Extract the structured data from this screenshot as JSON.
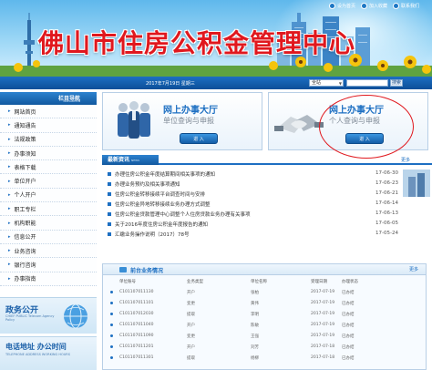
{
  "header": {
    "title": "佛山市住房公积金管理中心",
    "top_links": [
      "设为首页",
      "加入收藏",
      "联系我们"
    ]
  },
  "navbar": {
    "date": "2017年7月19日  星期三",
    "search_scope": "全站",
    "search_button": "搜索"
  },
  "sidebar": {
    "heading": "栏目导航",
    "heading_en": "NAVIGATION",
    "items": [
      "网站首页",
      "通知通告",
      "法规政策",
      "办事须知",
      "表格下载",
      "单位开户",
      "个人开户",
      "职工专栏",
      "机构职能",
      "信息公开",
      "业务咨询",
      "银行咨询",
      "办事指南"
    ],
    "gov_title": "政务公开",
    "gov_sub": "CHIEF PUBLIC Telecom Agency Policy",
    "phone_title": "电话地址  办公时间",
    "phone_sub": "TELEPHONE ADDRESS WORKING HOURS"
  },
  "cards": {
    "unit": {
      "title": "网上办事大厅",
      "sub": "单位查询与申报",
      "enter": "进 入"
    },
    "personal": {
      "title": "网上办事大厅",
      "sub": "个人查询与申报",
      "enter": "进 入"
    }
  },
  "news": {
    "heading": "最新资讯",
    "heading_en": "NEWS",
    "more": "更多",
    "items": [
      {
        "title": "办理住房公积金年度结算期间相关事项的通知",
        "date": "17-06-30"
      },
      {
        "title": "办理业务预约及相关事项通知",
        "date": "17-06-23"
      },
      {
        "title": "住房公积金转移接续平台调查时间与安排",
        "date": "17-06-21"
      },
      {
        "title": "住房公积金异地转移接续业务办理方式调整",
        "date": "17-06-14"
      },
      {
        "title": "住房公积金贷款管理中心调整个人住房贷款业务办理有关事项",
        "date": "17-06-13"
      },
      {
        "title": "关于2016年度住房公积金年度报告的通知",
        "date": "17-06-05"
      },
      {
        "title": "汇缴业务操作说明（2017）78号",
        "date": "17-05-24"
      }
    ]
  },
  "business": {
    "heading": "前台业务情况",
    "more": "更多",
    "columns": [
      "单位账号",
      "业务类型",
      "单位名称",
      "受理日期",
      "办理状态"
    ],
    "rows": [
      [
        "C101107011130",
        "开户",
        "张柏",
        "2017-07-19",
        "已办结"
      ],
      [
        "C101107011101",
        "变更",
        "黄伟",
        "2017-07-19",
        "已办结"
      ],
      [
        "C101107012030",
        "提取",
        "李明",
        "2017-07-19",
        "已办结"
      ],
      [
        "C101107011040",
        "开户",
        "陈敏",
        "2017-07-19",
        "已办结"
      ],
      [
        "C101107011090",
        "变更",
        "王强",
        "2017-07-19",
        "已办结"
      ],
      [
        "C101107011201",
        "开户",
        "刘芳",
        "2017-07-18",
        "已办结"
      ],
      [
        "C101107011301",
        "提取",
        "杨柳",
        "2017-07-18",
        "已办结"
      ]
    ]
  },
  "colors": {
    "brand_blue": "#1d6fc2",
    "title_red": "#e0181e",
    "annotation_red": "#e0181e"
  }
}
